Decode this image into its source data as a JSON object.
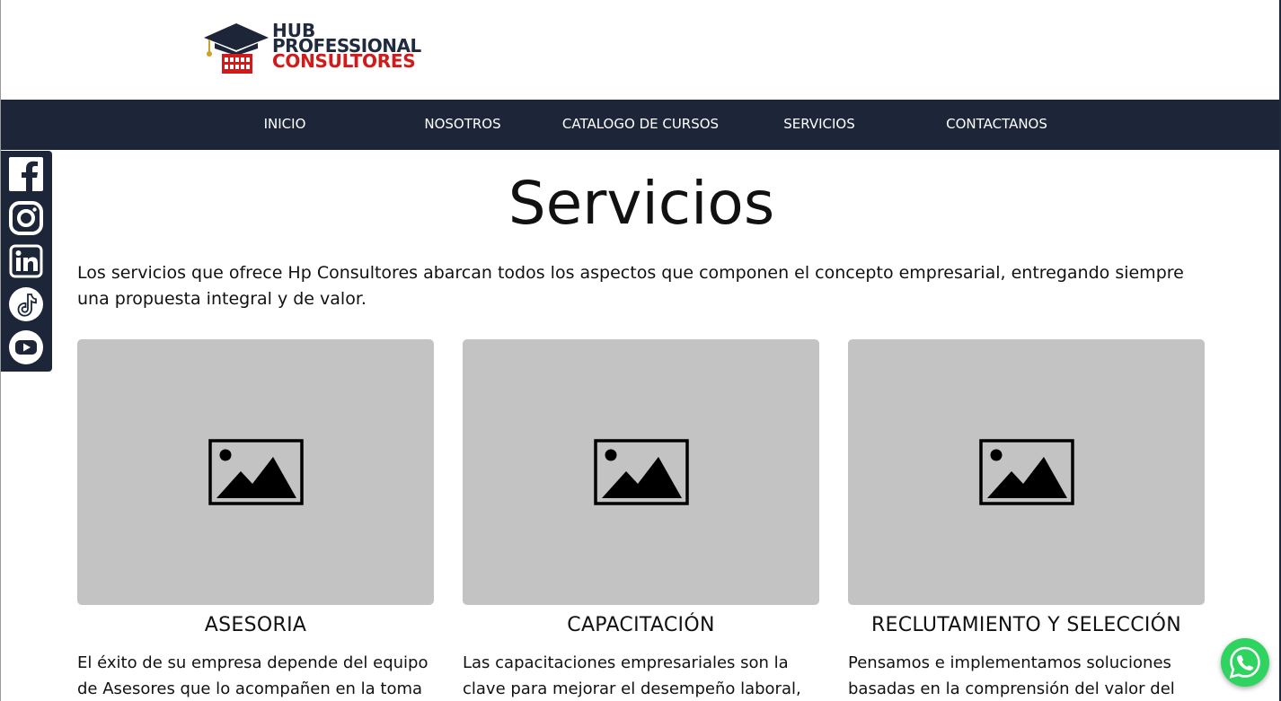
{
  "logo": {
    "line1": "HUB",
    "line2": "PROFESSIONAL",
    "line3": "CONSULTORES"
  },
  "nav": {
    "items": [
      {
        "label": "INICIO"
      },
      {
        "label": "NOSOTROS"
      },
      {
        "label": "CATALOGO DE CURSOS"
      },
      {
        "label": "SERVICIOS"
      },
      {
        "label": "CONTACTANOS"
      }
    ]
  },
  "social": {
    "icons": [
      "facebook-icon",
      "instagram-icon",
      "linkedin-icon",
      "tiktok-icon",
      "youtube-icon"
    ]
  },
  "page": {
    "title": "Servicios",
    "intro": "Los servicios que ofrece Hp Consultores abarcan todos los aspectos que componen el concepto empresarial, entregando siempre una propuesta integral y de valor."
  },
  "cards": [
    {
      "title": "ASESORIA",
      "text": "El éxito de su empresa depende del equipo de Asesores que lo acompañen en la toma"
    },
    {
      "title": "CAPACITACIÓN",
      "text": "Las capacitaciones empresariales son la clave para mejorar el desempeño laboral,"
    },
    {
      "title": "RECLUTAMIENTO Y SELECCIÓN",
      "text": "Pensamos e implementamos soluciones basadas en la comprensión del valor del"
    }
  ],
  "colors": {
    "nav_bg": "#1d2638",
    "brand_red": "#d11a1a",
    "placeholder_bg": "#c3c3c3",
    "whatsapp": "#2fd35f"
  }
}
